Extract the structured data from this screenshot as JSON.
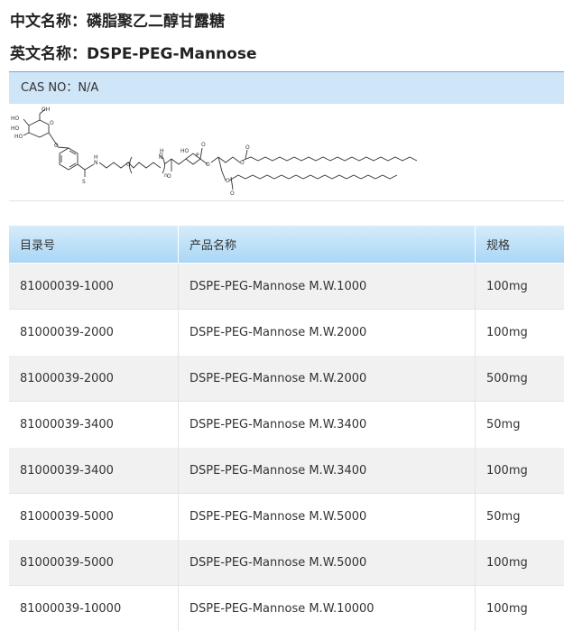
{
  "header": {
    "cn_label": "中文名称：",
    "cn_value": "磷脂聚乙二醇甘露糖",
    "en_label": "英文名称：",
    "en_value": "DSPE-PEG-Mannose"
  },
  "cas": {
    "label": "CAS NO：",
    "value": "N/A"
  },
  "structure_labels": {
    "ho1": "HO",
    "oh1": "OH",
    "ho2": "HO",
    "ho3": "HO",
    "o1": "O",
    "o2": "O",
    "o3": "O",
    "n1": "N",
    "n2": "N",
    "h1": "H",
    "h2": "H",
    "s": "S",
    "n_sub": "n",
    "o4": "O",
    "o5": "O",
    "o6": "O",
    "p": "P",
    "ho4": "HO",
    "o7": "O",
    "o8": "O",
    "o9": "O",
    "o10": "O",
    "o11": "O"
  },
  "table": {
    "columns": [
      "目录号",
      "产品名称",
      "规格"
    ],
    "rows": [
      {
        "catalog": "81000039-1000",
        "name": "DSPE-PEG-Mannose M.W.1000",
        "spec": "100mg"
      },
      {
        "catalog": "81000039-2000",
        "name": "DSPE-PEG-Mannose M.W.2000",
        "spec": "100mg"
      },
      {
        "catalog": "81000039-2000",
        "name": "DSPE-PEG-Mannose M.W.2000",
        "spec": "500mg"
      },
      {
        "catalog": "81000039-3400",
        "name": "DSPE-PEG-Mannose M.W.3400",
        "spec": "50mg"
      },
      {
        "catalog": "81000039-3400",
        "name": "DSPE-PEG-Mannose M.W.3400",
        "spec": "100mg"
      },
      {
        "catalog": "81000039-5000",
        "name": "DSPE-PEG-Mannose M.W.5000",
        "spec": "50mg"
      },
      {
        "catalog": "81000039-5000",
        "name": "DSPE-PEG-Mannose M.W.5000",
        "spec": "100mg"
      },
      {
        "catalog": "81000039-10000",
        "name": "DSPE-PEG-Mannose M.W.10000",
        "spec": "100mg"
      }
    ]
  }
}
